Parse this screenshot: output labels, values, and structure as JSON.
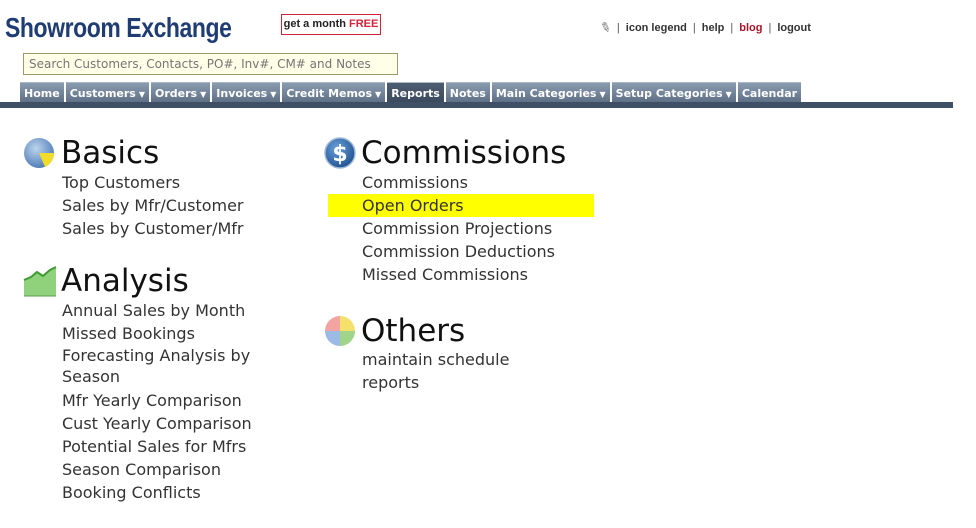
{
  "header": {
    "logo": "Showroom Exchange",
    "promo_prefix": "get a month ",
    "promo_highlight": "FREE",
    "links": [
      "icon legend",
      "help",
      "blog",
      "logout"
    ],
    "pin_glyph": "✎"
  },
  "search": {
    "placeholder": "Search Customers, Contacts, PO#, Inv#, CM# and Notes"
  },
  "nav": [
    {
      "label": "Home",
      "dropdown": false
    },
    {
      "label": "Customers",
      "dropdown": true
    },
    {
      "label": "Orders",
      "dropdown": true
    },
    {
      "label": "Invoices",
      "dropdown": true
    },
    {
      "label": "Credit Memos",
      "dropdown": true
    },
    {
      "label": "Reports",
      "dropdown": false,
      "active": true
    },
    {
      "label": "Notes",
      "dropdown": false
    },
    {
      "label": "Main Categories",
      "dropdown": true
    },
    {
      "label": "Setup Categories",
      "dropdown": true
    },
    {
      "label": "Calendar",
      "dropdown": false
    }
  ],
  "sections": {
    "basics": {
      "title": "Basics",
      "links": [
        "Top Customers",
        "Sales by Mfr/Customer",
        "Sales by Customer/Mfr"
      ]
    },
    "analysis": {
      "title": "Analysis",
      "links": [
        "Annual Sales by Month",
        "Missed Bookings",
        "Forecasting Analysis by Season",
        "Mfr Yearly Comparison",
        "Cust Yearly Comparison",
        "Potential Sales for Mfrs",
        "Season Comparison",
        "Booking Conflicts"
      ]
    },
    "commissions": {
      "title": "Commissions",
      "links": [
        "Commissions",
        "Open Orders",
        "Commission Projections",
        "Commission Deductions",
        "Missed Commissions"
      ],
      "highlighted": "Open Orders"
    },
    "others": {
      "title": "Others",
      "links": [
        "maintain schedule",
        "reports"
      ]
    }
  },
  "colors": {
    "highlight": "#ffff00",
    "nav": "#6b7c92",
    "blog_link": "#a8162a",
    "promo_border": "#d0243b"
  }
}
